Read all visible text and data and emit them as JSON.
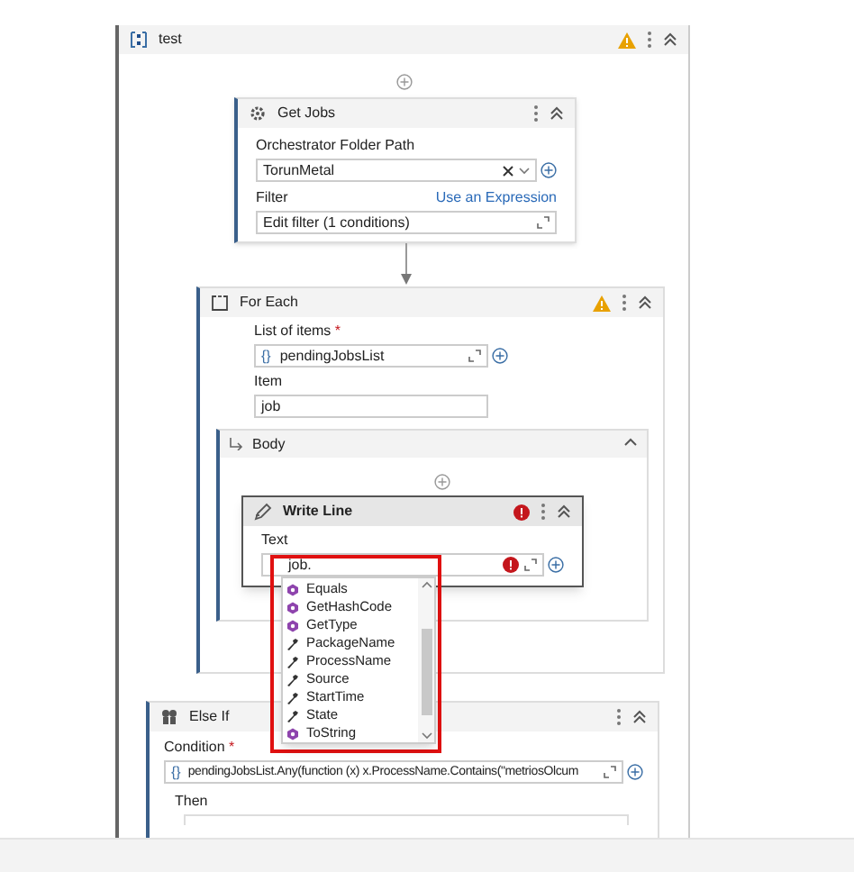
{
  "panel": {
    "title": "test",
    "warning": true
  },
  "get_jobs": {
    "title": "Get Jobs",
    "folder_label": "Orchestrator Folder Path",
    "folder_value": "TorunMetal",
    "filter_label": "Filter",
    "filter_link": "Use an Expression",
    "filter_value": "Edit filter (1 conditions)"
  },
  "for_each": {
    "title": "For Each",
    "warning": true,
    "list_label": "List of items",
    "required_mark": "*",
    "list_prefix": "{}",
    "list_value": "pendingJobsList",
    "item_label": "Item",
    "item_value": "job",
    "body_title": "Body"
  },
  "write_line": {
    "title": "Write Line",
    "error": true,
    "text_label": "Text",
    "text_value": "job.",
    "text_error": true
  },
  "autocomplete": [
    {
      "label": "Equals",
      "kind": "method"
    },
    {
      "label": "GetHashCode",
      "kind": "method"
    },
    {
      "label": "GetType",
      "kind": "method"
    },
    {
      "label": "PackageName",
      "kind": "property"
    },
    {
      "label": "ProcessName",
      "kind": "property"
    },
    {
      "label": "Source",
      "kind": "property"
    },
    {
      "label": "StartTime",
      "kind": "property"
    },
    {
      "label": "State",
      "kind": "property"
    },
    {
      "label": "ToString",
      "kind": "method"
    }
  ],
  "else_if": {
    "title": "Else If",
    "condition_label": "Condition",
    "required_mark": "*",
    "condition_prefix": "{}",
    "condition_value": "pendingJobsList.Any(function (x) x.ProcessName.Contains(\"metriosOlcum",
    "then_label": "Then"
  }
}
